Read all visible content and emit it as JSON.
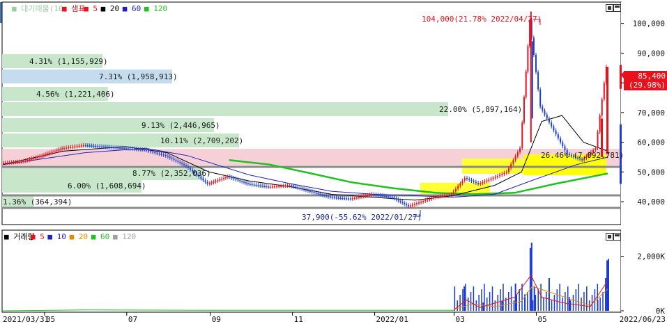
{
  "main_panel": {
    "legend": [
      {
        "text": "■ 대기매물(10)",
        "color": "#9ccfa0"
      },
      {
        "text": "■ 샘표",
        "color": "#e8111c"
      },
      {
        "text": "■ 5",
        "color": "#e8111c"
      },
      {
        "text": "■ 20",
        "color": "#000000"
      },
      {
        "text": "■ 60",
        "color": "#2020c0"
      },
      {
        "text": "■ 120",
        "color": "#21c021"
      }
    ],
    "max_annotation": "104,000(21.78% 2022/04/27)",
    "min_annotation": "37,900(-55.62% 2022/01/27)",
    "current_price": "85,400",
    "current_change": "(29.98%)",
    "y_ticks": [
      "100,000",
      "90,000",
      "80,000",
      "70,000",
      "60,000",
      "50,000",
      "40,000"
    ],
    "supply_bars": [
      {
        "label": "4.31% (1,155,929)"
      },
      {
        "label": "7.31% (1,958,913)"
      },
      {
        "label": "4.56% (1,221,406)"
      },
      {
        "label": "22.00% (5,897,164)"
      },
      {
        "label": "9.13% (2,446,965)"
      },
      {
        "label": "10.11% (2,709,202)"
      },
      {
        "label": "26.46% (7,092,781)"
      },
      {
        "label": "8.77% (2,352,036)"
      },
      {
        "label": "6.00% (1,608,694)"
      },
      {
        "label": "1.36% (364,394)"
      }
    ]
  },
  "volume_panel": {
    "legend": [
      {
        "text": "■ 거래량",
        "color": "#000000"
      },
      {
        "text": "■ 5",
        "color": "#e8111c"
      },
      {
        "text": "■ 10",
        "color": "#2020c0"
      },
      {
        "text": "■ 20",
        "color": "#e08a00"
      },
      {
        "text": "■ 60",
        "color": "#21c021"
      },
      {
        "text": "■ 120",
        "color": "#a0a0a0"
      }
    ],
    "y_ticks": [
      "2,000K",
      "0K"
    ]
  },
  "x_axis": {
    "start_label": "2021/03/31",
    "end_label": "2022/06/23",
    "ticks": [
      "05",
      "07",
      "09",
      "11",
      "2022/01",
      "03",
      "05"
    ]
  },
  "side_tab_label": "호",
  "chart_data": {
    "type": "candlestick",
    "title": "샘표",
    "period": [
      "2021/03/31",
      "2022/06/23"
    ],
    "price_ylim": [
      33000,
      106000
    ],
    "current_price": 85400,
    "current_change_pct": 29.98,
    "high": {
      "value": 104000,
      "pct": 21.78,
      "date": "2022/04/27"
    },
    "low": {
      "value": 37900,
      "pct": -55.62,
      "date": "2022/01/27"
    },
    "close_series": [
      {
        "date": "2021/03/31",
        "value": 53000
      },
      {
        "date": "2021/04/15",
        "value": 53500
      },
      {
        "date": "2021/04/30",
        "value": 55500
      },
      {
        "date": "2021/05/15",
        "value": 58000
      },
      {
        "date": "2021/05/31",
        "value": 59000
      },
      {
        "date": "2021/06/15",
        "value": 58500
      },
      {
        "date": "2021/06/30",
        "value": 58000
      },
      {
        "date": "2021/07/15",
        "value": 57500
      },
      {
        "date": "2021/07/31",
        "value": 55500
      },
      {
        "date": "2021/08/15",
        "value": 52000
      },
      {
        "date": "2021/08/31",
        "value": 46000
      },
      {
        "date": "2021/09/15",
        "value": 48500
      },
      {
        "date": "2021/09/30",
        "value": 46000
      },
      {
        "date": "2021/10/15",
        "value": 45000
      },
      {
        "date": "2021/10/31",
        "value": 45500
      },
      {
        "date": "2021/11/15",
        "value": 43500
      },
      {
        "date": "2021/11/30",
        "value": 41500
      },
      {
        "date": "2021/12/15",
        "value": 41000
      },
      {
        "date": "2021/12/31",
        "value": 42500
      },
      {
        "date": "2022/01/15",
        "value": 41500
      },
      {
        "date": "2022/01/27",
        "value": 38500
      },
      {
        "date": "2022/02/15",
        "value": 41500
      },
      {
        "date": "2022/02/28",
        "value": 42500
      },
      {
        "date": "2022/03/10",
        "value": 48000
      },
      {
        "date": "2022/03/20",
        "value": 46000
      },
      {
        "date": "2022/03/31",
        "value": 48000
      },
      {
        "date": "2022/04/10",
        "value": 50000
      },
      {
        "date": "2022/04/20",
        "value": 58000
      },
      {
        "date": "2022/04/27",
        "value": 101000
      },
      {
        "date": "2022/05/05",
        "value": 72000
      },
      {
        "date": "2022/05/15",
        "value": 64000
      },
      {
        "date": "2022/05/25",
        "value": 56000
      },
      {
        "date": "2022/06/05",
        "value": 54000
      },
      {
        "date": "2022/06/15",
        "value": 58000
      },
      {
        "date": "2022/06/23",
        "value": 85400
      }
    ],
    "ma20": [
      {
        "date": "2021/03/31",
        "value": 52500
      },
      {
        "date": "2021/05/15",
        "value": 57000
      },
      {
        "date": "2021/06/30",
        "value": 58500
      },
      {
        "date": "2021/07/31",
        "value": 56500
      },
      {
        "date": "2021/08/31",
        "value": 50000
      },
      {
        "date": "2021/09/30",
        "value": 47000
      },
      {
        "date": "2021/10/31",
        "value": 45000
      },
      {
        "date": "2021/11/30",
        "value": 42500
      },
      {
        "date": "2021/12/31",
        "value": 41500
      },
      {
        "date": "2022/01/31",
        "value": 40500
      },
      {
        "date": "2022/02/28",
        "value": 42000
      },
      {
        "date": "2022/03/31",
        "value": 45500
      },
      {
        "date": "2022/04/20",
        "value": 50000
      },
      {
        "date": "2022/05/05",
        "value": 67000
      },
      {
        "date": "2022/05/20",
        "value": 69000
      },
      {
        "date": "2022/06/05",
        "value": 60000
      },
      {
        "date": "2022/06/23",
        "value": 57000
      }
    ],
    "ma60": [
      {
        "date": "2021/03/31",
        "value": 52500
      },
      {
        "date": "2021/05/31",
        "value": 56500
      },
      {
        "date": "2021/07/15",
        "value": 58000
      },
      {
        "date": "2021/08/15",
        "value": 55500
      },
      {
        "date": "2021/09/30",
        "value": 49000
      },
      {
        "date": "2021/10/31",
        "value": 46000
      },
      {
        "date": "2021/11/30",
        "value": 43500
      },
      {
        "date": "2021/12/31",
        "value": 42500
      },
      {
        "date": "2022/01/31",
        "value": 42000
      },
      {
        "date": "2022/02/28",
        "value": 41500
      },
      {
        "date": "2022/03/31",
        "value": 42500
      },
      {
        "date": "2022/04/30",
        "value": 47500
      },
      {
        "date": "2022/05/31",
        "value": 52500
      },
      {
        "date": "2022/06/23",
        "value": 55000
      }
    ],
    "ma120": [
      {
        "date": "2021/09/15",
        "value": 54000
      },
      {
        "date": "2021/10/15",
        "value": 52500
      },
      {
        "date": "2021/11/15",
        "value": 49500
      },
      {
        "date": "2021/12/15",
        "value": 46500
      },
      {
        "date": "2022/01/15",
        "value": 44500
      },
      {
        "date": "2022/02/15",
        "value": 43000
      },
      {
        "date": "2022/03/15",
        "value": 42500
      },
      {
        "date": "2022/04/15",
        "value": 43000
      },
      {
        "date": "2022/05/15",
        "value": 46000
      },
      {
        "date": "2022/06/23",
        "value": 49500
      }
    ],
    "supply_zones": [
      {
        "price_low": 97500,
        "price_high": 102500,
        "pct": 4.31,
        "volume": 1155929
      },
      {
        "price_low": 87500,
        "price_high": 92500,
        "pct": 7.31,
        "volume": 1958913
      },
      {
        "price_low": 82500,
        "price_high": 87500,
        "pct": 4.56,
        "volume": 1221406
      },
      {
        "price_low": 75000,
        "price_high": 80000,
        "pct": 22.0,
        "volume": 5897164
      },
      {
        "price_low": 67500,
        "price_high": 72500,
        "pct": 9.13,
        "volume": 2446965
      },
      {
        "price_low": 62500,
        "price_high": 67500,
        "pct": 10.11,
        "volume": 2709202
      },
      {
        "price_low": 55000,
        "price_high": 60000,
        "pct": 26.46,
        "volume": 7092781
      },
      {
        "price_low": 50000,
        "price_high": 55000,
        "pct": 8.77,
        "volume": 2352036
      },
      {
        "price_low": 42500,
        "price_high": 47500,
        "pct": 6.0,
        "volume": 1608694
      },
      {
        "price_low": 37500,
        "price_high": 42500,
        "pct": 1.36,
        "volume": 364394
      }
    ],
    "volume_ylim": [
      0,
      2600000
    ],
    "volume_series": [
      {
        "date": "2022/03/08",
        "value": 900000
      },
      {
        "date": "2022/03/22",
        "value": 300000
      },
      {
        "date": "2022/04/05",
        "value": 350000
      },
      {
        "date": "2022/04/15",
        "value": 1000000
      },
      {
        "date": "2022/04/22",
        "value": 600000
      },
      {
        "date": "2022/04/26",
        "value": 2300000
      },
      {
        "date": "2022/04/27",
        "value": 2500000
      },
      {
        "date": "2022/04/29",
        "value": 900000
      },
      {
        "date": "2022/05/10",
        "value": 1200000
      },
      {
        "date": "2022/05/25",
        "value": 500000
      },
      {
        "date": "2022/06/15",
        "value": 400000
      },
      {
        "date": "2022/06/21",
        "value": 1200000
      },
      {
        "date": "2022/06/22",
        "value": 1850000
      },
      {
        "date": "2022/06/23",
        "value": 1900000
      }
    ]
  }
}
